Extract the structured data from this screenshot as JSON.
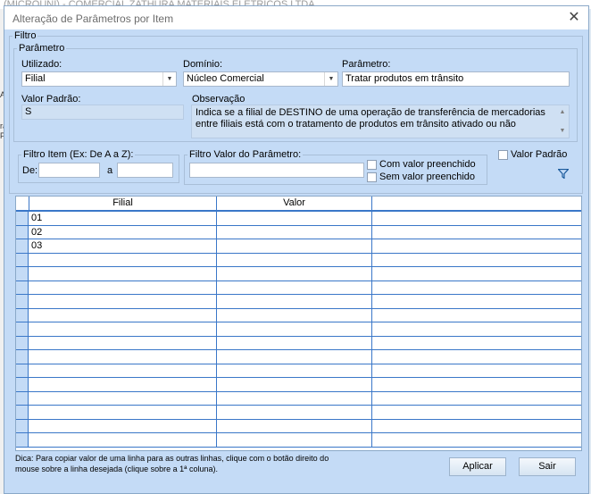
{
  "background": {
    "window_title": "(MICROUNI) - COMERCIAL ZATHURA MATERIAIS ELETRICOS LTDA",
    "strip_items": [
      "A",
      "ra",
      "Pa"
    ]
  },
  "dialog": {
    "title": "Alteração de Parâmetros por Item",
    "close_glyph": "✕"
  },
  "filtro": {
    "legend": "Filtro",
    "parametro_group": {
      "legend": "Parâmetro",
      "utilizado_label": "Utilizado:",
      "utilizado_value": "Filial",
      "dominio_label": "Domínio:",
      "dominio_value": "Núcleo Comercial",
      "parametro_label": "Parâmetro:",
      "parametro_value": "Tratar produtos em trânsito",
      "valor_padrao_label": "Valor Padrão:",
      "valor_padrao_value": "S",
      "observacao_label": "Observação",
      "observacao_text": "Indica se a filial de DESTINO de uma operação de transferência de mercadorias entre filiais está com o tratamento de produtos em trânsito ativado ou não"
    },
    "filtro_item": {
      "legend": "Filtro Item (Ex: De A a Z):",
      "de_label": "De:",
      "de_value": "",
      "a_label": "a",
      "a_value": ""
    },
    "filtro_valor": {
      "legend": "Filtro Valor do Parâmetro:",
      "value": "",
      "com_valor_label": "Com valor preenchido",
      "com_valor_checked": false,
      "sem_valor_label": "Sem valor preenchido",
      "sem_valor_checked": false
    },
    "valor_padrao_check_label": "Valor Padrão",
    "valor_padrao_checked": false,
    "filter_icon": "filter-funnel-icon"
  },
  "grid": {
    "columns": [
      "Filial",
      "Valor"
    ],
    "rows": [
      {
        "filial": "01",
        "valor": ""
      },
      {
        "filial": "02",
        "valor": ""
      },
      {
        "filial": "03",
        "valor": ""
      }
    ],
    "empty_rows": 14
  },
  "footer": {
    "hint": "Dica: Para copiar valor de uma linha para as outras linhas, clique com o botão direito do mouse sobre a linha desejada (clique sobre a 1ª coluna).",
    "aplicar_label": "Aplicar",
    "sair_label": "Sair"
  },
  "colors": {
    "dialog_bg": "#c4dbf6",
    "grid_lines": "#3a77c8",
    "accent": "#3a77c8"
  }
}
